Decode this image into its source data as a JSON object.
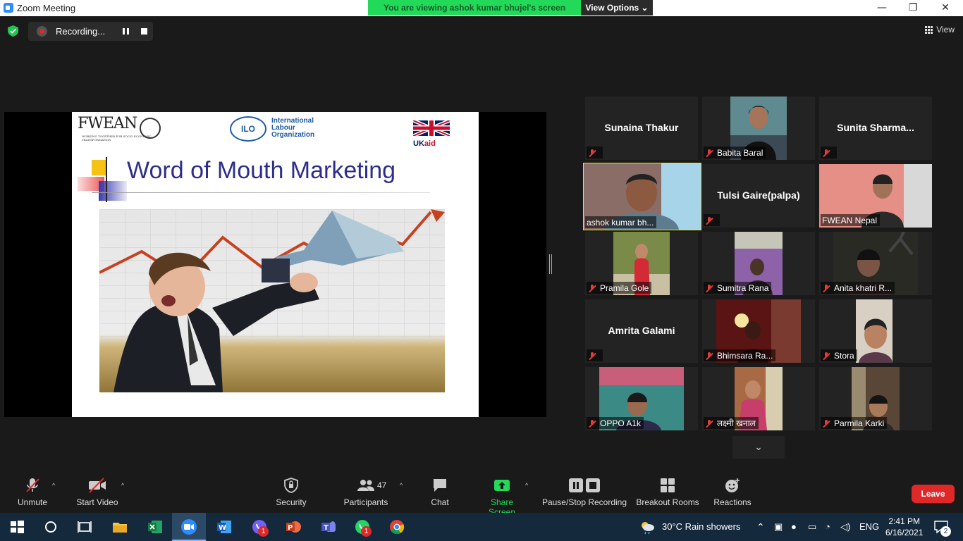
{
  "window": {
    "title": "Zoom Meeting",
    "minimize": "—",
    "restore": "❐",
    "close": "✕"
  },
  "banner": {
    "text": "You are viewing ashok kumar bhujel's screen",
    "view_options": "View Options ⌄"
  },
  "recording": {
    "label": "Recording..."
  },
  "view_button": {
    "label": "View"
  },
  "slide": {
    "fwean_logo": "FWEAN",
    "fwean_tagline": "WORKING TOGETHER FOR SOCIO ECONOMIC TRANSFORMATION",
    "ilo_emblem": "ILO",
    "ilo_name": [
      "International",
      "Labour",
      "Organization"
    ],
    "ukaid": {
      "uk": "UK",
      "aid": "aid"
    },
    "title": "Word of Mouth Marketing"
  },
  "participants": [
    {
      "name": "Sunaina Thakur",
      "video": false,
      "muted": true
    },
    {
      "name": "Babita Baral",
      "video": true,
      "muted": true
    },
    {
      "name": "Sunita  Sharma...",
      "video": false,
      "muted": true
    },
    {
      "name": "ashok kumar bh...",
      "video": true,
      "muted": false,
      "active_speaker": true
    },
    {
      "name": "Tulsi Gaire(palpa)",
      "video": false,
      "muted": true
    },
    {
      "name": "FWEAN Nepal",
      "video": true,
      "muted": false
    },
    {
      "name": "Pramila Gole",
      "video": true,
      "muted": true
    },
    {
      "name": "Sumitra Rana",
      "video": true,
      "muted": true
    },
    {
      "name": "Anita khatri R...",
      "video": true,
      "muted": true
    },
    {
      "name": "Amrita Galami",
      "video": false,
      "muted": true
    },
    {
      "name": "Bhimsara Ra...",
      "video": true,
      "muted": true
    },
    {
      "name": "Stora",
      "video": true,
      "muted": true
    },
    {
      "name": "OPPO A1k",
      "video": true,
      "muted": true
    },
    {
      "name": "लक्ष्मी खनाल",
      "video": true,
      "muted": true
    },
    {
      "name": "Parmila Karki",
      "video": true,
      "muted": true
    }
  ],
  "gallery_next": "⌄",
  "toolbar": {
    "unmute": "Unmute",
    "start_video": "Start Video",
    "security": "Security",
    "participants": "Participants",
    "participant_count": "47",
    "chat": "Chat",
    "share_screen": "Share Screen",
    "pause_stop_recording": "Pause/Stop Recording",
    "breakout_rooms": "Breakout Rooms",
    "reactions": "Reactions",
    "leave": "Leave",
    "caret": "^"
  },
  "taskbar": {
    "weather": "30°C  Rain showers",
    "lang": "ENG",
    "time": "2:41 PM",
    "date": "6/16/2021",
    "notifications": "2",
    "viber_badge": "1",
    "whatsapp_badge": "1"
  },
  "colors": {
    "banner_green": "#23d959",
    "active_speaker": "#e6e629",
    "leave_red": "#e02828",
    "share_green": "#23d959",
    "taskbar": "#14293b"
  }
}
